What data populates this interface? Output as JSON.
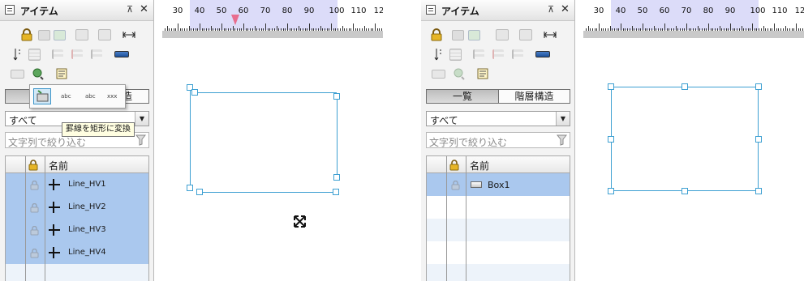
{
  "colors": {
    "selection_blue": "#3ea0d2",
    "row_selected": "#aac8ee",
    "ruler_highlight": "#dcdcf9",
    "ruler_marker": "#e86d8f",
    "tooltip_bg": "#fffee1"
  },
  "left": {
    "panel": {
      "title": "アイテム",
      "pin_glyph": "⊼",
      "close_glyph": "✕",
      "toolbar_icons": [
        "lock-icon",
        "send-back-icon",
        "bring-front-icon",
        "item-group-icon",
        "item-ungroup-icon",
        "horizontal-spacing-icon",
        "vertical-spacing-icon",
        "table-icon",
        "align-icon",
        "align-icon-2",
        "align-icon-3",
        "line-style-icon",
        "convert-line-icon",
        "convert-shape-icon",
        "properties-icon"
      ],
      "tabs": {
        "first": "",
        "second": "造"
      },
      "filter_select": {
        "value": "すべて"
      },
      "search": {
        "placeholder": "文字列で絞り込む"
      },
      "list": {
        "header_name": "名前",
        "rows": [
          {
            "label": "Line_HV1"
          },
          {
            "label": "Line_HV2"
          },
          {
            "label": "Line_HV3"
          },
          {
            "label": "Line_HV4"
          }
        ]
      }
    },
    "popup": {
      "items": [
        "convert-to-rect-icon",
        "abc-icon",
        "abc-icon-2",
        "xxx-icon"
      ],
      "labels": [
        "abc",
        "abc",
        "xxx"
      ]
    },
    "tooltip": "罫線を矩形に変換",
    "ruler": {
      "labels": [
        "30",
        "40",
        "50",
        "60",
        "70",
        "80",
        "90",
        "100",
        "110",
        "12"
      ],
      "marker_value": 56
    }
  },
  "right": {
    "panel": {
      "title": "アイテム",
      "pin_glyph": "⊼",
      "close_glyph": "✕",
      "tabs": {
        "first": "一覧",
        "second": "階層構造"
      },
      "filter_select": {
        "value": "すべて"
      },
      "search": {
        "placeholder": "文字列で絞り込む"
      },
      "list": {
        "header_name": "名前",
        "rows": [
          {
            "label": "Box1"
          }
        ]
      }
    },
    "ruler": {
      "labels": [
        "30",
        "40",
        "50",
        "60",
        "70",
        "80",
        "90",
        "100",
        "110",
        "12"
      ]
    }
  }
}
